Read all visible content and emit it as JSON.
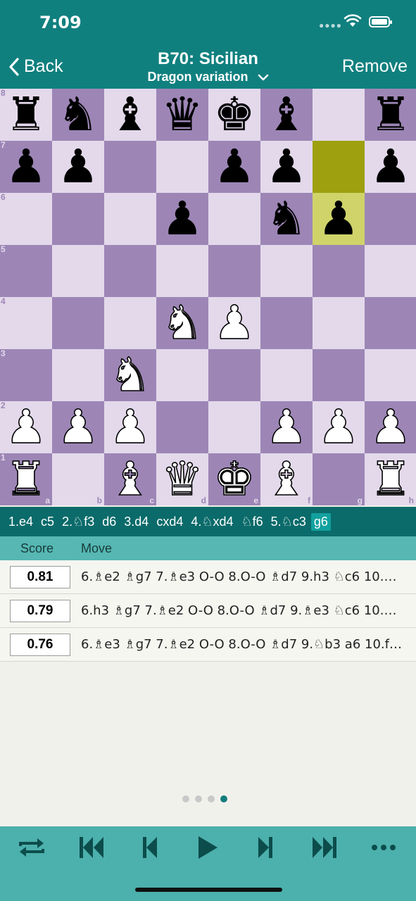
{
  "status": {
    "time": "7:09"
  },
  "nav": {
    "back_label": "Back",
    "title": "B70: Sicilian",
    "subtitle": "Dragon variation",
    "remove_label": "Remove"
  },
  "board": {
    "files": [
      "a",
      "b",
      "c",
      "d",
      "e",
      "f",
      "g",
      "h"
    ],
    "ranks": [
      "8",
      "7",
      "6",
      "5",
      "4",
      "3",
      "2",
      "1"
    ],
    "rows": [
      [
        "br",
        "bn",
        "bb",
        "bq",
        "bk",
        "bb",
        "",
        "br"
      ],
      [
        "bp",
        "bp",
        "",
        "",
        "bp",
        "bp",
        "",
        "bp"
      ],
      [
        "",
        "",
        "",
        "bp",
        "",
        "bn",
        "bp",
        ""
      ],
      [
        "",
        "",
        "",
        "",
        "",
        "",
        "",
        ""
      ],
      [
        "",
        "",
        "",
        "wn",
        "wp",
        "",
        "",
        ""
      ],
      [
        "",
        "",
        "wn",
        "",
        "",
        "",
        "",
        ""
      ],
      [
        "wp",
        "wp",
        "wp",
        "",
        "",
        "wp",
        "wp",
        "wp"
      ],
      [
        "wr",
        "",
        "wb",
        "wq",
        "wk",
        "wb",
        "",
        "wr"
      ]
    ],
    "last_move": {
      "from": "g7",
      "to": "g6"
    }
  },
  "moves": [
    "1.e4",
    "c5",
    "2.♘f3",
    "d6",
    "3.d4",
    "cxd4",
    "4.♘xd4",
    "♘f6",
    "5.♘c3",
    "g6"
  ],
  "current_move_index": 9,
  "engine": {
    "score_header": "Score",
    "move_header": "Move",
    "lines": [
      {
        "score": "0.81",
        "pv": "6.♗e2 ♗g7 7.♗e3 O-O 8.O-O ♗d7 9.h3 ♘c6 10.…"
      },
      {
        "score": "0.79",
        "pv": "6.h3 ♗g7 7.♗e2 O-O 8.O-O ♗d7 9.♗e3 ♘c6 10.…"
      },
      {
        "score": "0.76",
        "pv": "6.♗e3 ♗g7 7.♗e2 O-O 8.O-O ♗d7 9.♘b3 a6 10.f…"
      }
    ]
  },
  "pager": {
    "count": 4,
    "active": 3
  },
  "toolbar": [
    "flip-board",
    "first-move",
    "previous-move",
    "play",
    "next-move",
    "last-move",
    "more"
  ],
  "colors": {
    "header": "#10807f",
    "move_strip": "#0a6b6a",
    "engine_header": "#56b7b3",
    "toolbar": "#4cb0ac",
    "light_square": "#e3d9eb",
    "dark_square": "#9d86b6",
    "last_move_from": "#9ea010",
    "last_move_to": "#cfd36a"
  }
}
